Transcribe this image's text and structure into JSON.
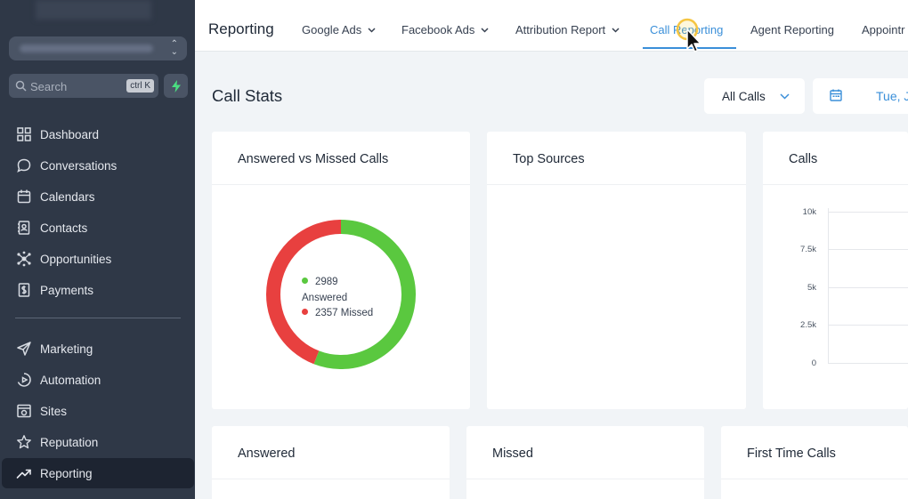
{
  "sidebar": {
    "search_placeholder": "Search",
    "search_shortcut": "ctrl K",
    "items": [
      {
        "label": "Dashboard",
        "icon": "dashboard-icon"
      },
      {
        "label": "Conversations",
        "icon": "chat-icon"
      },
      {
        "label": "Calendars",
        "icon": "calendar-icon"
      },
      {
        "label": "Contacts",
        "icon": "contacts-icon"
      },
      {
        "label": "Opportunities",
        "icon": "opportunities-icon"
      },
      {
        "label": "Payments",
        "icon": "payments-icon"
      },
      {
        "label": "Marketing",
        "icon": "send-icon"
      },
      {
        "label": "Automation",
        "icon": "automation-icon"
      },
      {
        "label": "Sites",
        "icon": "sites-icon"
      },
      {
        "label": "Reputation",
        "icon": "star-icon"
      },
      {
        "label": "Reporting",
        "icon": "trending-icon"
      }
    ],
    "active_item": "Reporting"
  },
  "topbar": {
    "title": "Reporting",
    "tabs": [
      {
        "label": "Google Ads",
        "dropdown": true
      },
      {
        "label": "Facebook Ads",
        "dropdown": true
      },
      {
        "label": "Attribution Report",
        "dropdown": true
      },
      {
        "label": "Call Reporting",
        "dropdown": false,
        "active": true
      },
      {
        "label": "Agent Reporting",
        "dropdown": false
      },
      {
        "label": "Appointr",
        "dropdown": false
      }
    ]
  },
  "main": {
    "title": "Call Stats",
    "filter_value": "All Calls",
    "date_text": "Tue, J"
  },
  "cards": {
    "answered_vs_missed": {
      "title": "Answered vs Missed Calls",
      "answered_value": "2989",
      "answered_label": "Answered",
      "missed_text": "2357 Missed"
    },
    "top_sources": {
      "title": "Top Sources"
    },
    "calls": {
      "title": "Calls",
      "y_ticks": [
        "10k",
        "7.5k",
        "5k",
        "2.5k",
        "0"
      ]
    },
    "answered": {
      "title": "Answered"
    },
    "missed": {
      "title": "Missed"
    },
    "first_time_calls": {
      "title": "First Time Calls"
    }
  },
  "colors": {
    "answered": "#5ac83f",
    "missed": "#e8403f",
    "accent": "#3a8fd9",
    "sidebar_bg": "#2f3847"
  },
  "chart_data": {
    "type": "pie",
    "categories": [
      "Answered",
      "Missed"
    ],
    "values": [
      2989,
      2357
    ]
  }
}
